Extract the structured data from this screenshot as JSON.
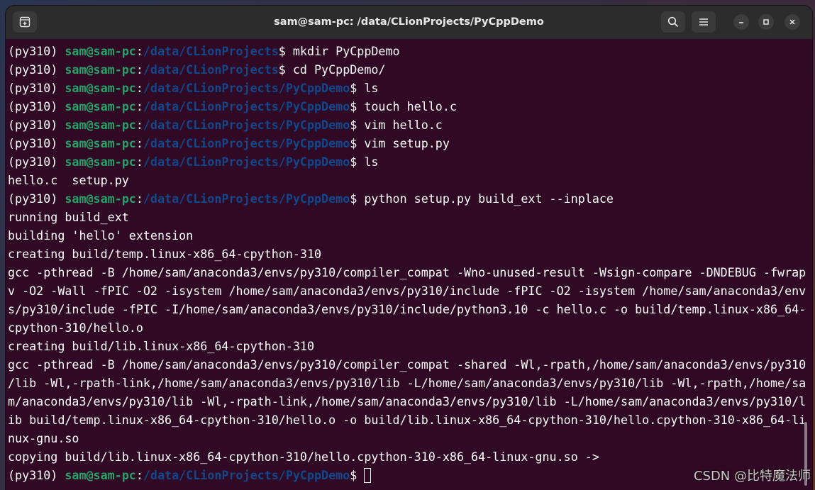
{
  "window": {
    "title": "sam@sam-pc: /data/CLionProjects/PyCppDemo"
  },
  "icons": {
    "new_tab": "new-tab-icon",
    "search": "search-icon",
    "menu": "hamburger-menu-icon",
    "minimize": "minimize-icon",
    "maximize": "maximize-icon",
    "close": "close-icon"
  },
  "colors": {
    "terminal_bg": "#300a24",
    "user_host": "#26a269",
    "path": "#12488b",
    "text": "#ffffff"
  },
  "terminal": {
    "lines": [
      {
        "type": "prompt",
        "env": "(py310) ",
        "user": "sam@sam-pc",
        "sep": ":",
        "path": "/data/CLionProjects",
        "dollar": "$ ",
        "cmd": "mkdir PyCppDemo"
      },
      {
        "type": "prompt",
        "env": "(py310) ",
        "user": "sam@sam-pc",
        "sep": ":",
        "path": "/data/CLionProjects",
        "dollar": "$ ",
        "cmd": "cd PyCppDemo/"
      },
      {
        "type": "prompt",
        "env": "(py310) ",
        "user": "sam@sam-pc",
        "sep": ":",
        "path": "/data/CLionProjects/PyCppDemo",
        "dollar": "$ ",
        "cmd": "ls"
      },
      {
        "type": "prompt",
        "env": "(py310) ",
        "user": "sam@sam-pc",
        "sep": ":",
        "path": "/data/CLionProjects/PyCppDemo",
        "dollar": "$ ",
        "cmd": "touch hello.c"
      },
      {
        "type": "prompt",
        "env": "(py310) ",
        "user": "sam@sam-pc",
        "sep": ":",
        "path": "/data/CLionProjects/PyCppDemo",
        "dollar": "$ ",
        "cmd": "vim hello.c"
      },
      {
        "type": "prompt",
        "env": "(py310) ",
        "user": "sam@sam-pc",
        "sep": ":",
        "path": "/data/CLionProjects/PyCppDemo",
        "dollar": "$ ",
        "cmd": "vim setup.py"
      },
      {
        "type": "prompt",
        "env": "(py310) ",
        "user": "sam@sam-pc",
        "sep": ":",
        "path": "/data/CLionProjects/PyCppDemo",
        "dollar": "$ ",
        "cmd": "ls"
      },
      {
        "type": "output",
        "text": "hello.c  setup.py"
      },
      {
        "type": "prompt",
        "env": "(py310) ",
        "user": "sam@sam-pc",
        "sep": ":",
        "path": "/data/CLionProjects/PyCppDemo",
        "dollar": "$ ",
        "cmd": "python setup.py build_ext --inplace"
      },
      {
        "type": "output",
        "text": "running build_ext"
      },
      {
        "type": "output",
        "text": "building 'hello' extension"
      },
      {
        "type": "output",
        "text": "creating build/temp.linux-x86_64-cpython-310"
      },
      {
        "type": "output",
        "text": "gcc -pthread -B /home/sam/anaconda3/envs/py310/compiler_compat -Wno-unused-result -Wsign-compare -DNDEBUG -fwrap"
      },
      {
        "type": "output",
        "text": "v -O2 -Wall -fPIC -O2 -isystem /home/sam/anaconda3/envs/py310/include -fPIC -O2 -isystem /home/sam/anaconda3/env"
      },
      {
        "type": "output",
        "text": "s/py310/include -fPIC -I/home/sam/anaconda3/envs/py310/include/python3.10 -c hello.c -o build/temp.linux-x86_64-"
      },
      {
        "type": "output",
        "text": "cpython-310/hello.o"
      },
      {
        "type": "output",
        "text": "creating build/lib.linux-x86_64-cpython-310"
      },
      {
        "type": "output",
        "text": "gcc -pthread -B /home/sam/anaconda3/envs/py310/compiler_compat -shared -Wl,-rpath,/home/sam/anaconda3/envs/py310"
      },
      {
        "type": "output",
        "text": "/lib -Wl,-rpath-link,/home/sam/anaconda3/envs/py310/lib -L/home/sam/anaconda3/envs/py310/lib -Wl,-rpath,/home/sa"
      },
      {
        "type": "output",
        "text": "m/anaconda3/envs/py310/lib -Wl,-rpath-link,/home/sam/anaconda3/envs/py310/lib -L/home/sam/anaconda3/envs/py310/l"
      },
      {
        "type": "output",
        "text": "ib build/temp.linux-x86_64-cpython-310/hello.o -o build/lib.linux-x86_64-cpython-310/hello.cpython-310-x86_64-li"
      },
      {
        "type": "output",
        "text": "nux-gnu.so"
      },
      {
        "type": "output",
        "text": "copying build/lib.linux-x86_64-cpython-310/hello.cpython-310-x86_64-linux-gnu.so ->"
      },
      {
        "type": "prompt",
        "env": "(py310) ",
        "user": "sam@sam-pc",
        "sep": ":",
        "path": "/data/CLionProjects/PyCppDemo",
        "dollar": "$ ",
        "cmd": "",
        "cursor": true
      }
    ]
  },
  "watermark": "CSDN @比特魔法师"
}
